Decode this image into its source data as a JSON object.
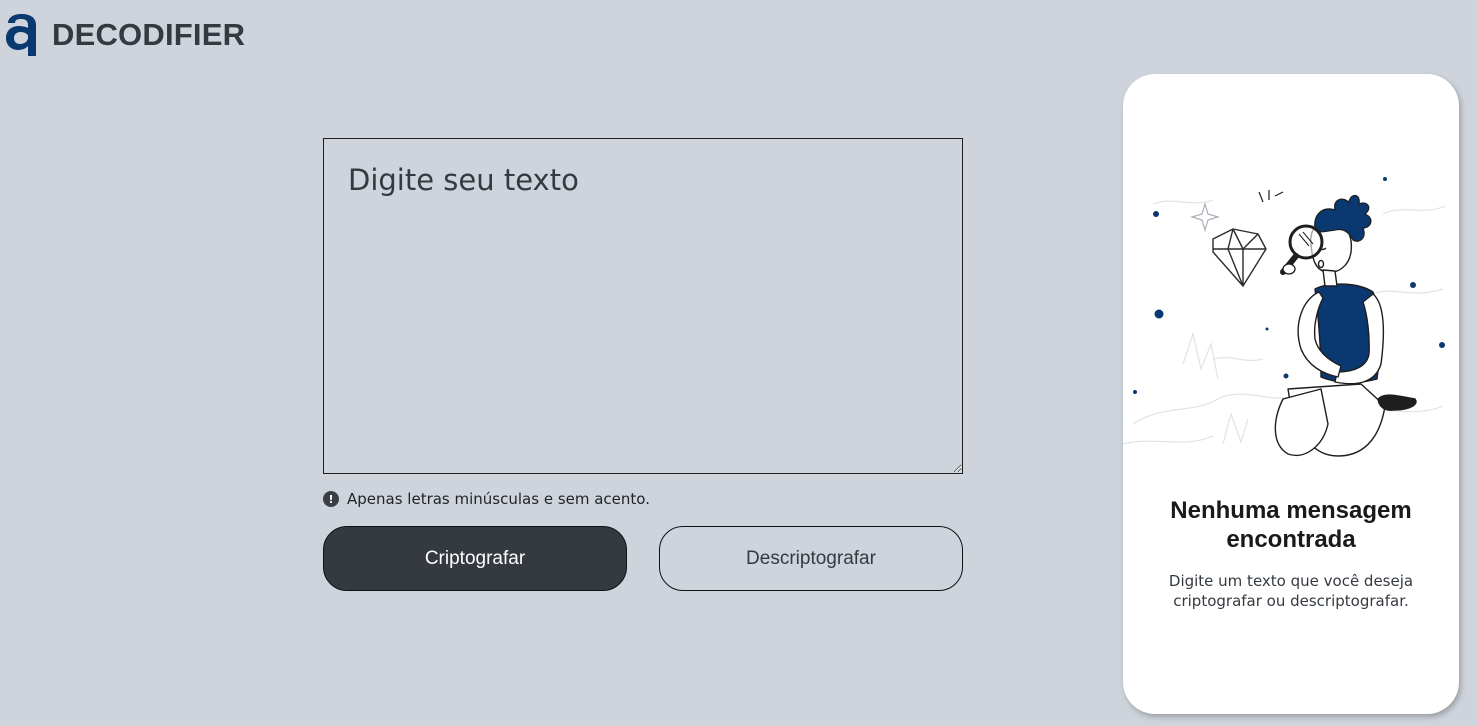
{
  "brand": {
    "name": "DECODIFIER",
    "logo_icon": "letter-a-logo-icon",
    "logo_color": "#0a3871"
  },
  "editor": {
    "placeholder": "Digite seu texto",
    "value": ""
  },
  "hint": {
    "icon": "exclamation-circle-icon",
    "text": "Apenas letras minúsculas e sem acento."
  },
  "actions": {
    "encrypt_label": "Criptografar",
    "decrypt_label": "Descriptografar"
  },
  "output": {
    "illustration": "person-with-magnifying-glass-and-diamond-illustration",
    "title": "Nenhuma mensagem encontrada",
    "message": "Digite um texto que você deseja criptografar ou descriptografar."
  },
  "colors": {
    "background": "#cfd4dc",
    "primary_button": "#343a40",
    "accent": "#0a3871",
    "card": "#ffffff"
  }
}
